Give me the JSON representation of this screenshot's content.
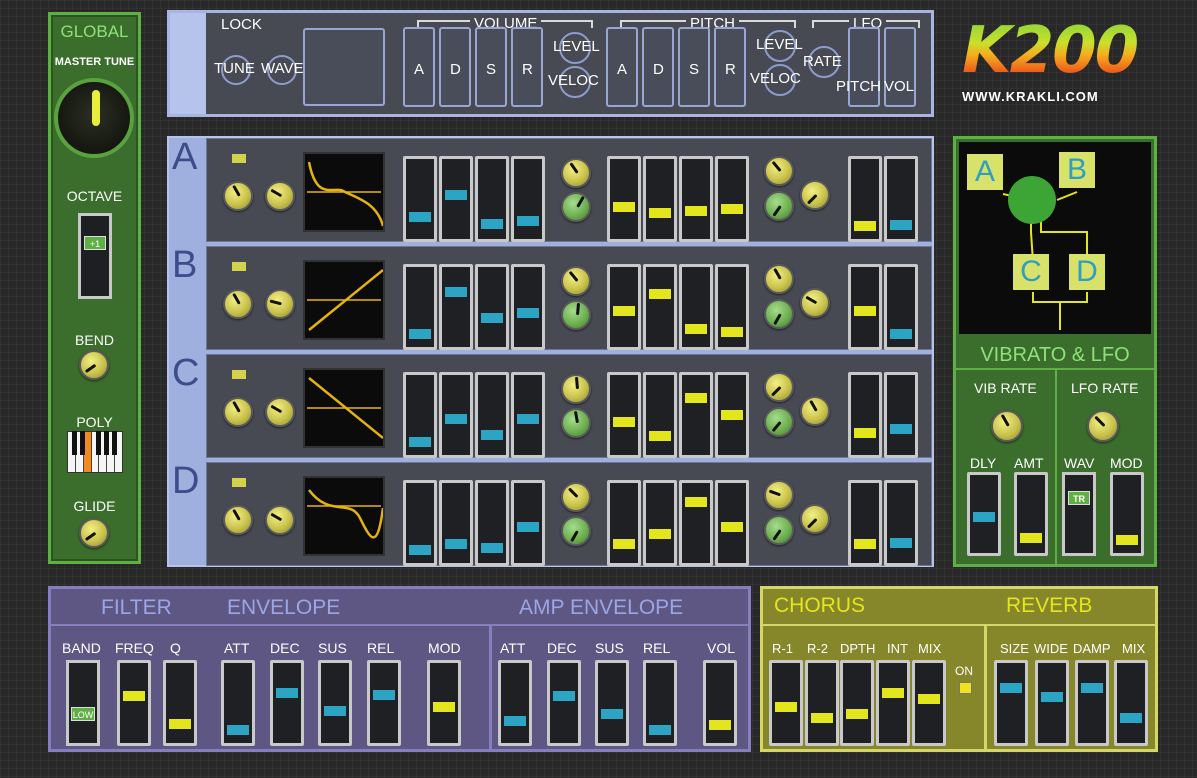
{
  "global": {
    "title": "GLOBAL",
    "master_tune": "MASTER TUNE",
    "octave": "OCTAVE",
    "octave_value": "+1",
    "bend": "BEND",
    "poly": "POLY",
    "glide": "GLIDE"
  },
  "top": {
    "lock": "LOCK",
    "tune": "TUNE",
    "wave": "WAVE",
    "volume": "VOLUME",
    "pitch": "PITCH",
    "lfo": "LFO",
    "a": "A",
    "d": "D",
    "s": "S",
    "r": "R",
    "level": "LEVEL",
    "veloc": "VELOC",
    "level2": "LEVEL",
    "veloc2": "VELOC",
    "rate": "RATE",
    "pitch_l": "PITCH",
    "vol": "VOL"
  },
  "logo": {
    "text": "K200",
    "url": "WWW.KRAKLI.COM"
  },
  "osc": [
    {
      "letter": "A",
      "vol": [
        0.25,
        0.55,
        0.15,
        0.18
      ],
      "pitch": [
        0.38,
        0.3,
        0.33,
        0.36
      ],
      "lfo": [
        0.12,
        0.13
      ]
    },
    {
      "letter": "B",
      "vol": [
        0.12,
        0.72,
        0.35,
        0.42
      ],
      "pitch": [
        0.45,
        0.68,
        0.18,
        0.15
      ],
      "lfo": [
        0.45,
        0.12
      ]
    },
    {
      "letter": "C",
      "vol": [
        0.12,
        0.45,
        0.22,
        0.45
      ],
      "pitch": [
        0.4,
        0.2,
        0.75,
        0.5
      ],
      "lfo": [
        0.25,
        0.3
      ]
    },
    {
      "letter": "D",
      "vol": [
        0.12,
        0.2,
        0.15,
        0.45
      ],
      "pitch": [
        0.2,
        0.35,
        0.8,
        0.45
      ],
      "lfo": [
        0.2,
        0.22
      ]
    }
  ],
  "vibrato": {
    "title": "VIBRATO & LFO",
    "vib_rate": "VIB RATE",
    "lfo_rate": "LFO RATE",
    "dly": "DLY",
    "amt": "AMT",
    "wav": "WAV",
    "mod": "MOD",
    "wav_value": "TR",
    "routing": {
      "a": "A",
      "b": "B",
      "c": "C",
      "d": "D"
    },
    "sliders": [
      0.45,
      0.15,
      0.12
    ]
  },
  "filter": {
    "title": "FILTER",
    "envelope": "ENVELOPE",
    "band": "BAND",
    "freq": "FREQ",
    "q": "Q",
    "att": "ATT",
    "dec": "DEC",
    "sus": "SUS",
    "rel": "REL",
    "mod": "MOD",
    "band_value": "LOW",
    "values": [
      0.6,
      0.2,
      0.12,
      0.65,
      0.38,
      0.62,
      0.45
    ]
  },
  "amp": {
    "title": "AMP ENVELOPE",
    "att": "ATT",
    "dec": "DEC",
    "sus": "SUS",
    "rel": "REL",
    "vol": "VOL",
    "values": [
      0.25,
      0.6,
      0.35,
      0.12,
      0.18
    ]
  },
  "chorus": {
    "title": "CHORUS",
    "r1": "R-1",
    "r2": "R-2",
    "dpth": "DPTH",
    "int": "INT",
    "mix": "MIX",
    "on": "ON",
    "values": [
      0.45,
      0.28,
      0.35,
      0.65,
      0.55
    ]
  },
  "reverb": {
    "title": "REVERB",
    "size": "SIZE",
    "wide": "WIDE",
    "damp": "DAMP",
    "mix": "MIX",
    "values": [
      0.72,
      0.58,
      0.72,
      0.28
    ]
  }
}
